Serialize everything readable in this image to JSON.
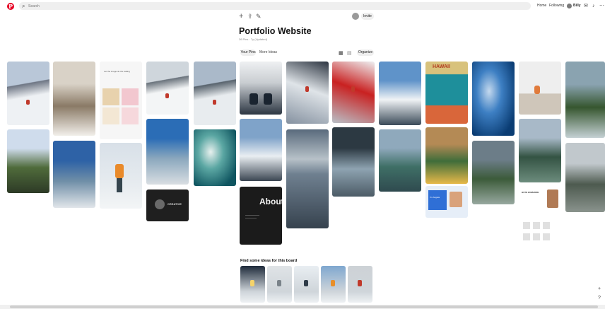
{
  "topbar": {
    "logo_letter": "P",
    "search_placeholder": "Search",
    "nav_home": "Home",
    "nav_following": "Following",
    "user_name": "Billy"
  },
  "board": {
    "title": "Portfolio Website",
    "meta": "36 Pins · 7y (Updated)",
    "invite_label": "Invite",
    "tabs": {
      "your_pins": "Your Pins",
      "more_ideas": "More Ideas"
    },
    "organize_label": "Organize"
  },
  "pins": [
    {
      "type": "ski",
      "sky": "#b9c7d8",
      "ground": "#eef1f4",
      "rock": "#6e7684"
    },
    {
      "type": "valley",
      "top": "#cfdcec",
      "mid": "#4f6b3b",
      "bot": "#2d3a26"
    },
    {
      "type": "cliff",
      "c1": "#d9d2c7",
      "c2": "#8a7a66",
      "c3": "#f2efea"
    },
    {
      "type": "lake",
      "c1": "#2e62a6",
      "c2": "#6f8ea7",
      "c3": "#e2e6ea"
    },
    {
      "type": "ui",
      "c1": "#f6f6f6",
      "c2": "#e8d2ad",
      "c3": "#f2c7cf"
    },
    {
      "type": "forest-skier",
      "c1": "#d8e0e8",
      "c2": "#e98a2a",
      "c3": "#35454e"
    },
    {
      "type": "snow-slope",
      "c1": "#cfd6dc",
      "c2": "#f3f5f6",
      "c3": "#6a737c"
    },
    {
      "type": "lake",
      "c1": "#2b6db6",
      "c2": "#8aa7bd",
      "c3": "#d9dee2"
    },
    {
      "type": "dark-card",
      "c1": "#1f1f1f",
      "c2": "#6a6a6a",
      "c3": "#d7d7d7"
    },
    {
      "type": "ski",
      "sky": "#aab9c9",
      "ground": "#e8ecef",
      "rock": "#58636d"
    },
    {
      "type": "wave",
      "c1": "#0f5560",
      "c2": "#5ba7a3",
      "c3": "#e7f0ee"
    },
    {
      "type": "boots",
      "c1": "#2c3642",
      "c2": "#c9cdd1",
      "c3": "#eef0f2"
    },
    {
      "type": "peak",
      "c1": "#7fa3c9",
      "c2": "#e9eef2",
      "c3": "#3b4652"
    },
    {
      "type": "dark-about",
      "c1": "#1b1b1b",
      "c2": "#f2f2f2",
      "c3": "#555"
    },
    {
      "type": "powder",
      "c1": "#2c3440",
      "c2": "#dfe4e8",
      "c3": "#8591a0"
    },
    {
      "type": "fuji",
      "c1": "#596a7c",
      "c2": "#b7c1c8",
      "c3": "#36424e"
    },
    {
      "type": "powder-light",
      "c1": "#eef0f2",
      "c2": "#c92121",
      "c3": "#b9c0c7"
    },
    {
      "type": "canoe",
      "c1": "#2c3942",
      "c2": "#8ea3b1",
      "c3": "#4c5b66"
    },
    {
      "type": "alpine",
      "c1": "#5f93c9",
      "c2": "#f0f3f5",
      "c3": "#3c4b59"
    },
    {
      "type": "alpine-lake",
      "c1": "#8fa9bc",
      "c2": "#3f6f66",
      "c3": "#2f4a4f"
    },
    {
      "type": "hawaii",
      "c1": "#d8c27c",
      "c2": "#1e8f9b",
      "c3": "#d9663a"
    },
    {
      "type": "flowers",
      "c1": "#b48a55",
      "c2": "#3f6d3a",
      "c3": "#e7b949"
    },
    {
      "type": "web-blue",
      "c1": "#2f6fd6",
      "c2": "#ffffff",
      "c3": "#e6eef8"
    },
    {
      "type": "deep-wave",
      "c1": "#0a3c73",
      "c2": "#3d7fc3",
      "c3": "#c4d9ee"
    },
    {
      "type": "valley-green",
      "c1": "#6c7d88",
      "c2": "#3c5b3a",
      "c3": "#97a89f"
    },
    {
      "type": "sitter",
      "c1": "#eeeeee",
      "c2": "#e07b3c",
      "c3": "#cfc6ba"
    },
    {
      "type": "pine-lake",
      "c1": "#a8b9c8",
      "c2": "#345343",
      "c3": "#6c8c7d"
    },
    {
      "type": "web-white",
      "c1": "#ffffff",
      "c2": "#2a2a2a",
      "c3": "#e0e0e0"
    },
    {
      "type": "waterfall",
      "c1": "#8aa3b0",
      "c2": "#36562f",
      "c3": "#c5d1d4"
    },
    {
      "type": "mist-forest",
      "c1": "#c1c8cc",
      "c2": "#4d5a4f",
      "c3": "#8a938d"
    }
  ],
  "pin_texts": {
    "ui_header": "Let the image do the talking",
    "dark_card_title": "CREATIVE",
    "about_title": "About",
    "hawaii_title": "HAWAII",
    "web_blue_title": "I'm Angela",
    "web_white_title": "HI I'M JOHN DOE"
  },
  "suggestions": {
    "title": "Find some ideas for this board",
    "items": [
      {
        "c1": "#1e2a3a",
        "c2": "#f5d36a"
      },
      {
        "c1": "#dfe3e6",
        "c2": "#7a838a"
      },
      {
        "c1": "#e9eef2",
        "c2": "#2f3c49"
      },
      {
        "c1": "#7fa7cf",
        "c2": "#e88f2a"
      },
      {
        "c1": "#cdd2d6",
        "c2": "#c0392b"
      }
    ]
  },
  "fab": {
    "plus": "+",
    "help": "?"
  }
}
